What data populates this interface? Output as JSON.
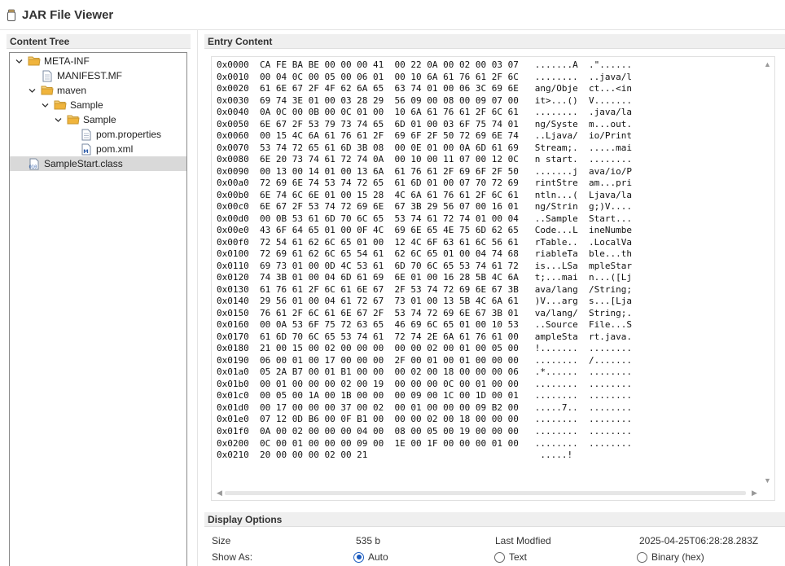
{
  "window": {
    "title": "JAR File Viewer"
  },
  "content_tree": {
    "header": "Content Tree",
    "items": [
      {
        "label": "META-INF",
        "icon": "folder-icon",
        "expanded": true
      },
      {
        "label": "MANIFEST.MF",
        "icon": "file-icon"
      },
      {
        "label": "maven",
        "icon": "folder-icon",
        "expanded": true
      },
      {
        "label": "Sample",
        "icon": "folder-icon",
        "expanded": true
      },
      {
        "label": "Sample",
        "icon": "folder-icon",
        "expanded": true
      },
      {
        "label": "pom.properties",
        "icon": "file-icon"
      },
      {
        "label": "pom.xml",
        "icon": "xml-file-icon"
      },
      {
        "label": "SampleStart.class",
        "icon": "class-file-icon",
        "selected": true
      }
    ]
  },
  "entry_content": {
    "header": "Entry Content",
    "lines": [
      "0x0000  CA FE BA BE 00 00 00 41  00 22 0A 00 02 00 03 07   .......A  .\"......",
      "0x0010  00 04 0C 00 05 00 06 01  00 10 6A 61 76 61 2F 6C   ........  ..java/l",
      "0x0020  61 6E 67 2F 4F 62 6A 65  63 74 01 00 06 3C 69 6E   ang/Obje  ct...<in",
      "0x0030  69 74 3E 01 00 03 28 29  56 09 00 08 00 09 07 00   it>...()  V.......",
      "0x0040  0A 0C 00 0B 00 0C 01 00  10 6A 61 76 61 2F 6C 61   ........  .java/la",
      "0x0050  6E 67 2F 53 79 73 74 65  6D 01 00 03 6F 75 74 01   ng/Syste  m...out.",
      "0x0060  00 15 4C 6A 61 76 61 2F  69 6F 2F 50 72 69 6E 74   ..Ljava/  io/Print",
      "0x0070  53 74 72 65 61 6D 3B 08  00 0E 01 00 0A 6D 61 69   Stream;.  .....mai",
      "0x0080  6E 20 73 74 61 72 74 0A  00 10 00 11 07 00 12 0C   n start.  ........",
      "0x0090  00 13 00 14 01 00 13 6A  61 76 61 2F 69 6F 2F 50   .......j  ava/io/P",
      "0x00a0  72 69 6E 74 53 74 72 65  61 6D 01 00 07 70 72 69   rintStre  am...pri",
      "0x00b0  6E 74 6C 6E 01 00 15 28  4C 6A 61 76 61 2F 6C 61   ntln...(  Ljava/la",
      "0x00c0  6E 67 2F 53 74 72 69 6E  67 3B 29 56 07 00 16 01   ng/Strin  g;)V....",
      "0x00d0  00 0B 53 61 6D 70 6C 65  53 74 61 72 74 01 00 04   ..Sample  Start...",
      "0x00e0  43 6F 64 65 01 00 0F 4C  69 6E 65 4E 75 6D 62 65   Code...L  ineNumbe",
      "0x00f0  72 54 61 62 6C 65 01 00  12 4C 6F 63 61 6C 56 61   rTable..  .LocalVa",
      "0x0100  72 69 61 62 6C 65 54 61  62 6C 65 01 00 04 74 68   riableTa  ble...th",
      "0x0110  69 73 01 00 0D 4C 53 61  6D 70 6C 65 53 74 61 72   is...LSa  mpleStar",
      "0x0120  74 3B 01 00 04 6D 61 69  6E 01 00 16 28 5B 4C 6A   t;...mai  n...([Lj",
      "0x0130  61 76 61 2F 6C 61 6E 67  2F 53 74 72 69 6E 67 3B   ava/lang  /String;",
      "0x0140  29 56 01 00 04 61 72 67  73 01 00 13 5B 4C 6A 61   )V...arg  s...[Lja",
      "0x0150  76 61 2F 6C 61 6E 67 2F  53 74 72 69 6E 67 3B 01   va/lang/  String;.",
      "0x0160  00 0A 53 6F 75 72 63 65  46 69 6C 65 01 00 10 53   ..Source  File...S",
      "0x0170  61 6D 70 6C 65 53 74 61  72 74 2E 6A 61 76 61 00   ampleSta  rt.java.",
      "0x0180  21 00 15 00 02 00 00 00  00 00 02 00 01 00 05 00   !.......  ........",
      "0x0190  06 00 01 00 17 00 00 00  2F 00 01 00 01 00 00 00   ........  /.......",
      "0x01a0  05 2A B7 00 01 B1 00 00  00 02 00 18 00 00 00 06   .*......  ........",
      "0x01b0  00 01 00 00 00 02 00 19  00 00 00 0C 00 01 00 00   ........  ........",
      "0x01c0  00 05 00 1A 00 1B 00 00  00 09 00 1C 00 1D 00 01   ........  ........",
      "0x01d0  00 17 00 00 00 37 00 02  00 01 00 00 00 09 B2 00   .....7..  ........",
      "0x01e0  07 12 0D B6 00 0F B1 00  00 00 02 00 18 00 00 00   ........  ........",
      "0x01f0  0A 00 02 00 00 00 04 00  08 00 05 00 19 00 00 00   ........  ........",
      "0x0200  0C 00 01 00 00 00 09 00  1E 00 1F 00 00 00 01 00   ........  ........",
      "0x0210  20 00 00 00 02 00 21                                .....!"
    ]
  },
  "display_options": {
    "header": "Display Options",
    "size_label": "Size",
    "size_value": "535 b",
    "modified_label": "Last Modfied",
    "modified_value": "2025-04-25T06:28:28.283Z",
    "show_as_label": "Show As:",
    "options": [
      {
        "label": "Auto",
        "selected": true
      },
      {
        "label": "Text",
        "selected": false
      },
      {
        "label": "Binary (hex)",
        "selected": false
      }
    ]
  },
  "colors": {
    "accent": "#1a5bbf",
    "folder": "#f0b43c",
    "selection": "#d9d9d9",
    "header_bg": "#efefef"
  }
}
